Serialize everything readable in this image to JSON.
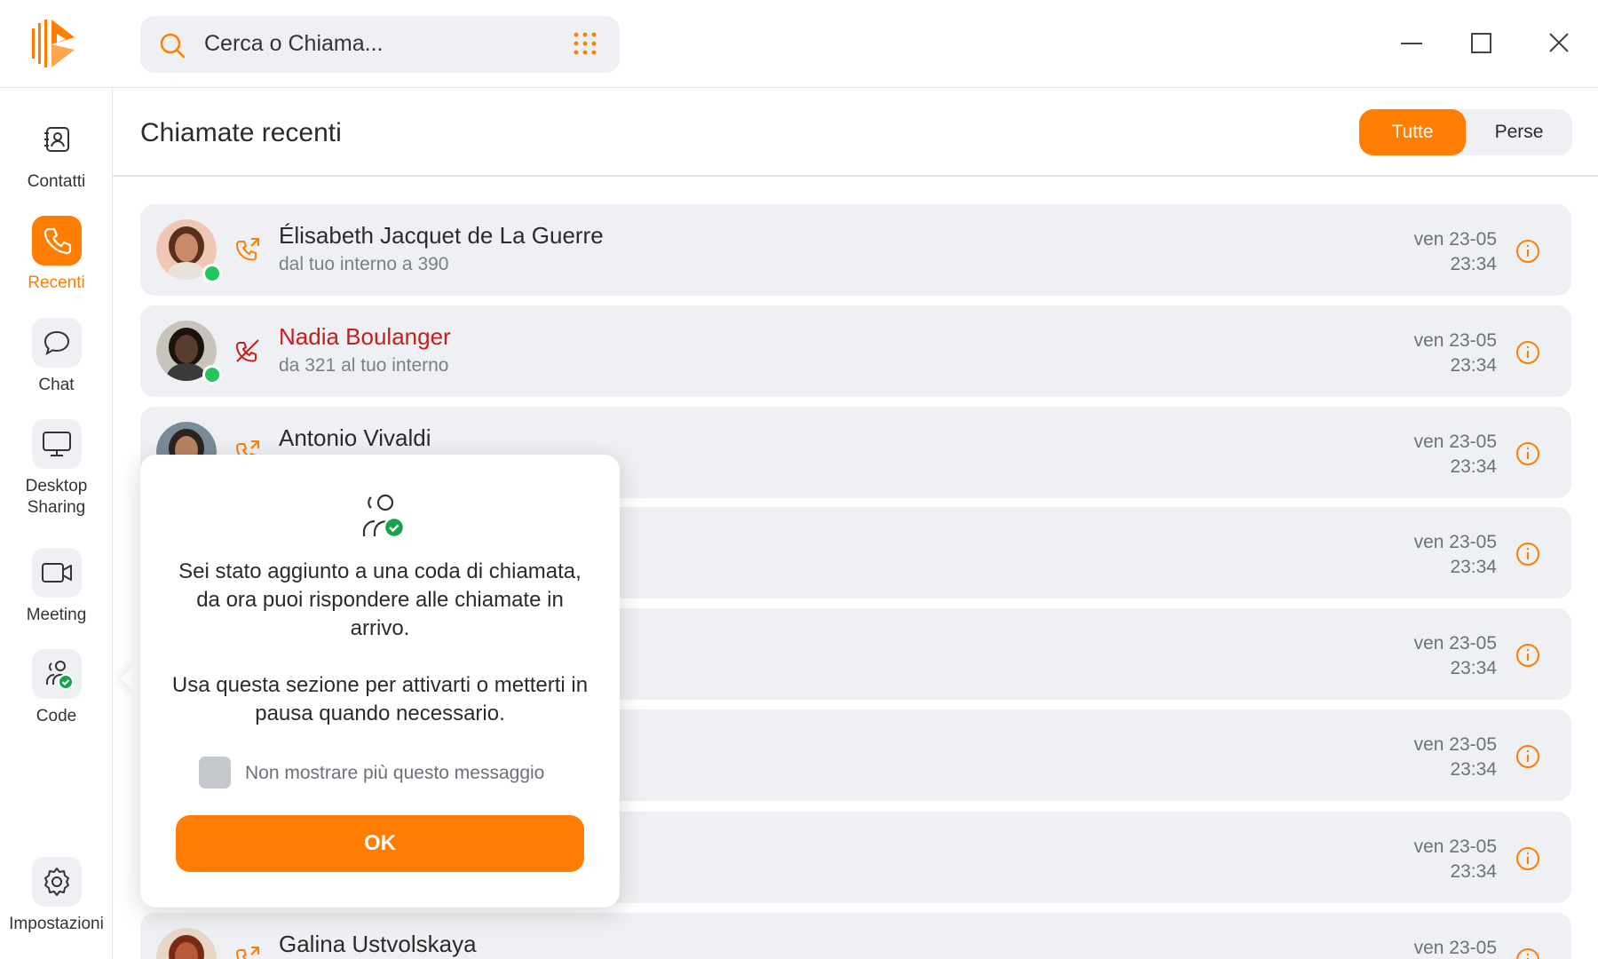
{
  "search": {
    "placeholder": "Cerca o Chiama..."
  },
  "sidebar": {
    "items": [
      {
        "label": "Contatti",
        "icon": "contacts-icon"
      },
      {
        "label": "Recenti",
        "icon": "phone-icon",
        "active": true
      },
      {
        "label": "Chat",
        "icon": "chat-bubble-icon"
      },
      {
        "label": "Desktop Sharing",
        "icon": "monitor-icon"
      },
      {
        "label": "Meeting",
        "icon": "video-camera-icon"
      },
      {
        "label": "Code",
        "icon": "queue-users-icon"
      },
      {
        "label": "Impostazioni",
        "icon": "gear-icon"
      }
    ]
  },
  "header": {
    "title": "Chiamate recenti",
    "filters": {
      "all": "Tutte",
      "missed": "Perse"
    }
  },
  "calls": [
    {
      "name": "Élisabeth Jacquet de La Guerre",
      "detail": "dal tuo interno a 390",
      "date": "ven 23-05",
      "time": "23:34",
      "type": "outgoing"
    },
    {
      "name": "Nadia Boulanger",
      "detail": "da 321 al tuo interno",
      "date": "ven 23-05",
      "time": "23:34",
      "type": "missed"
    },
    {
      "name": "Antonio Vivaldi",
      "detail": "",
      "date": "ven 23-05",
      "time": "23:34",
      "type": "outgoing"
    },
    {
      "name": "",
      "detail": "",
      "date": "ven 23-05",
      "time": "23:34",
      "type": ""
    },
    {
      "name": "",
      "detail": "",
      "date": "ven 23-05",
      "time": "23:34",
      "type": ""
    },
    {
      "name": "",
      "detail": "",
      "date": "ven 23-05",
      "time": "23:34",
      "type": ""
    },
    {
      "name": "",
      "detail": "",
      "date": "ven 23-05",
      "time": "23:34",
      "type": ""
    },
    {
      "name": "Galina Ustvolskaya",
      "detail": "",
      "date": "ven 23-05",
      "time": "",
      "type": "outgoing"
    }
  ],
  "popover": {
    "message1": "Sei stato aggiunto a una coda di chiamata, da ora puoi rispondere alle chiamate in arrivo.",
    "message2": "Usa questa sezione per attivarti o metterti in pausa quando necessario.",
    "checkbox_label": "Non mostrare più questo messaggio",
    "ok_label": "OK"
  },
  "colors": {
    "accent": "#ff7d00",
    "missed": "#c61d1d",
    "online": "#22c55e"
  }
}
